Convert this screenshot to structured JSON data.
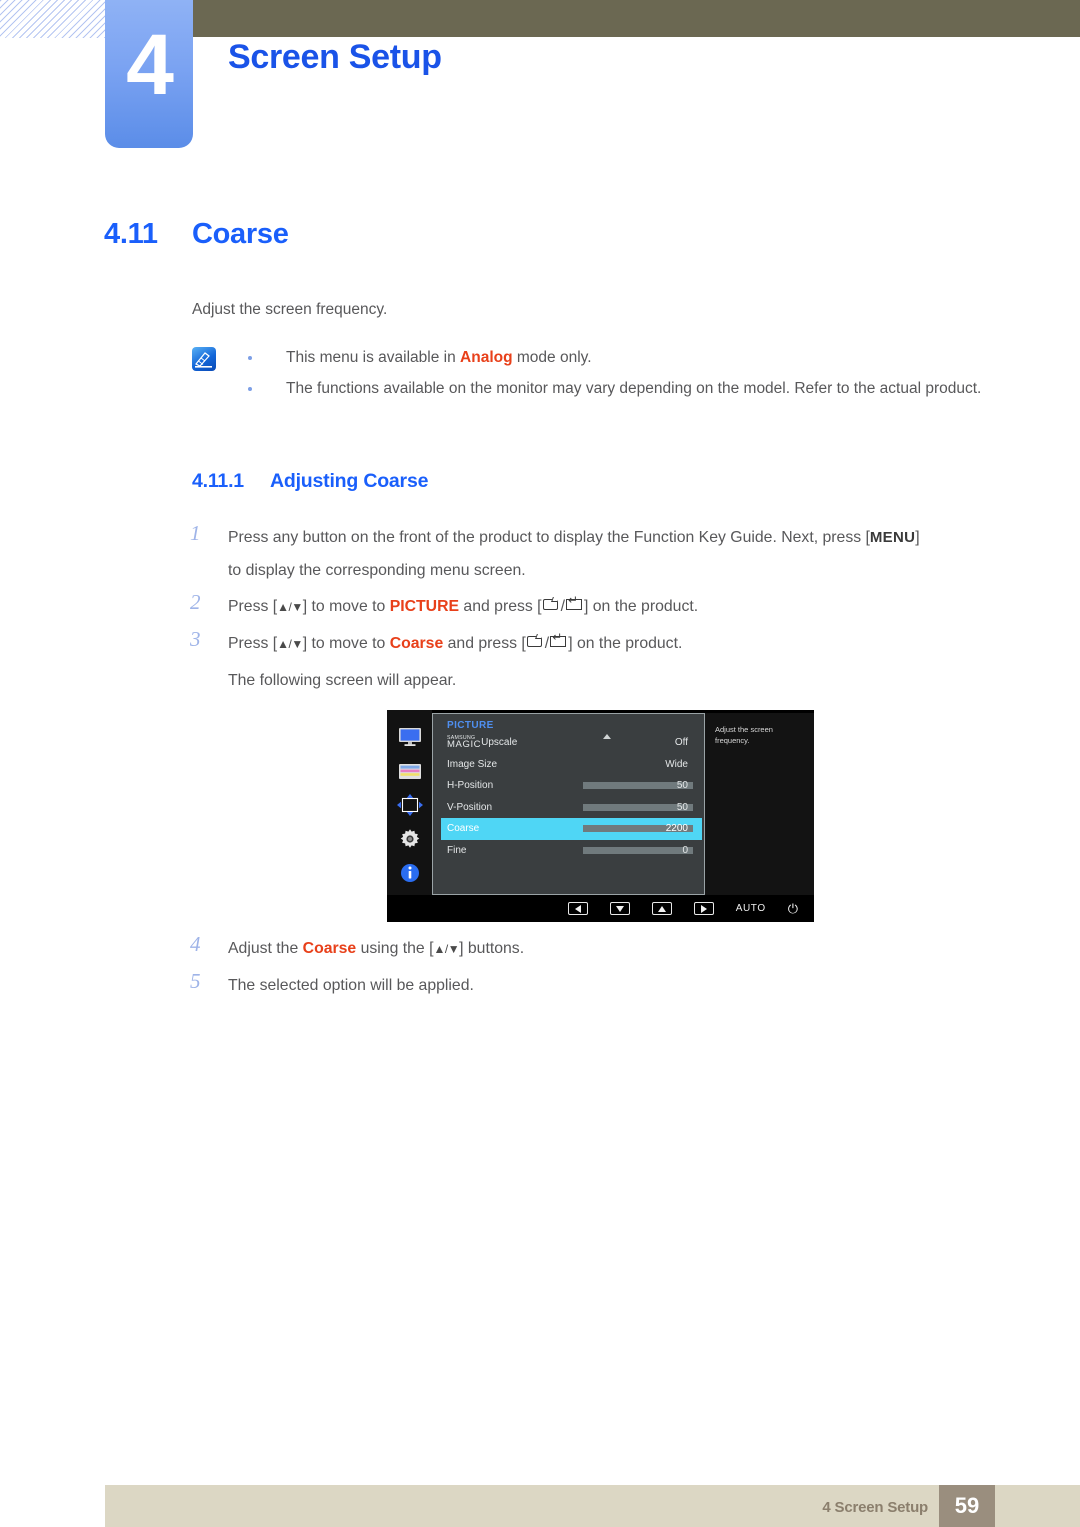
{
  "header": {
    "chapter_number": "4",
    "chapter_title": "Screen Setup",
    "hatch_icon": "diagonal-hatch-pattern",
    "olive_color": "#6b6852",
    "tab_color": "#7ba3f2",
    "title_color": "#1a53e8"
  },
  "section": {
    "number": "4.11",
    "title": "Coarse",
    "intro": "Adjust the screen frequency."
  },
  "note": {
    "icon": "note-pencil-icon",
    "items": [
      {
        "pre": "This menu is available in ",
        "highlight": "Analog",
        "post": " mode only."
      },
      {
        "pre": "The functions available on the monitor may vary depending on the model. Refer to the actual product.",
        "highlight": "",
        "post": ""
      }
    ],
    "highlight_color": "#e8401a"
  },
  "subsection": {
    "number": "4.11.1",
    "title": "Adjusting Coarse"
  },
  "steps_before": [
    {
      "num": "1",
      "line1_a": "Press any button on the front of the product to display the Function Key Guide. Next, press [",
      "key": "MENU",
      "line1_b": "]",
      "line2": "to display the corresponding menu screen."
    },
    {
      "num": "2",
      "a": "Press [",
      "arrows": "▲/▼",
      "b": "] to move to ",
      "target": "PICTURE",
      "c": " and press [",
      "d": "/",
      "e": "] on the product."
    },
    {
      "num": "3",
      "a": "Press [",
      "arrows": "▲/▼",
      "b": "] to move to ",
      "target": "Coarse",
      "c": " and press [",
      "d": "/",
      "e": "] on the product.",
      "sub": "The following screen will appear."
    }
  ],
  "steps_after": [
    {
      "num": "4",
      "a": "Adjust the ",
      "target": "Coarse",
      "b": " using the [",
      "arrows": "▲/▼",
      "c": "] buttons."
    },
    {
      "num": "5",
      "a": "The selected option will be applied.",
      "target": "",
      "b": "",
      "arrows": "",
      "c": ""
    }
  ],
  "osd": {
    "title": "PICTURE",
    "side_note": "Adjust the screen frequency.",
    "icons": [
      "monitor-picture-icon",
      "color-bars-icon",
      "position-arrows-icon",
      "gear-settings-icon",
      "info-circle-icon"
    ],
    "rows": [
      {
        "label_prefix": "SAMSUNG",
        "label_main": "MAGIC",
        "label_suffix": "Upscale",
        "value": "Off",
        "slider": null,
        "selected": false,
        "is_magic": true
      },
      {
        "label": "Image Size",
        "value": "Wide",
        "slider": null,
        "selected": false
      },
      {
        "label": "H-Position",
        "value": "50",
        "slider": 50,
        "selected": false
      },
      {
        "label": "V-Position",
        "value": "50",
        "slider": 50,
        "selected": false
      },
      {
        "label": "Coarse",
        "value": "2200",
        "slider": 50,
        "selected": true
      },
      {
        "label": "Fine",
        "value": "0",
        "slider": 0,
        "selected": false
      }
    ],
    "buttons": [
      {
        "name": "left-arrow-button",
        "glyph": "left"
      },
      {
        "name": "down-arrow-button",
        "glyph": "down"
      },
      {
        "name": "up-arrow-button",
        "glyph": "up"
      },
      {
        "name": "right-arrow-button",
        "glyph": "right"
      }
    ],
    "auto_label": "AUTO",
    "power_icon": "power-icon",
    "highlight_color": "#4fd6f5",
    "panel_bg": "#3a3e40"
  },
  "footer": {
    "text": "4 Screen Setup",
    "page": "59",
    "bar_color": "#dcd7c4",
    "page_box_color": "#9a8e7e"
  }
}
